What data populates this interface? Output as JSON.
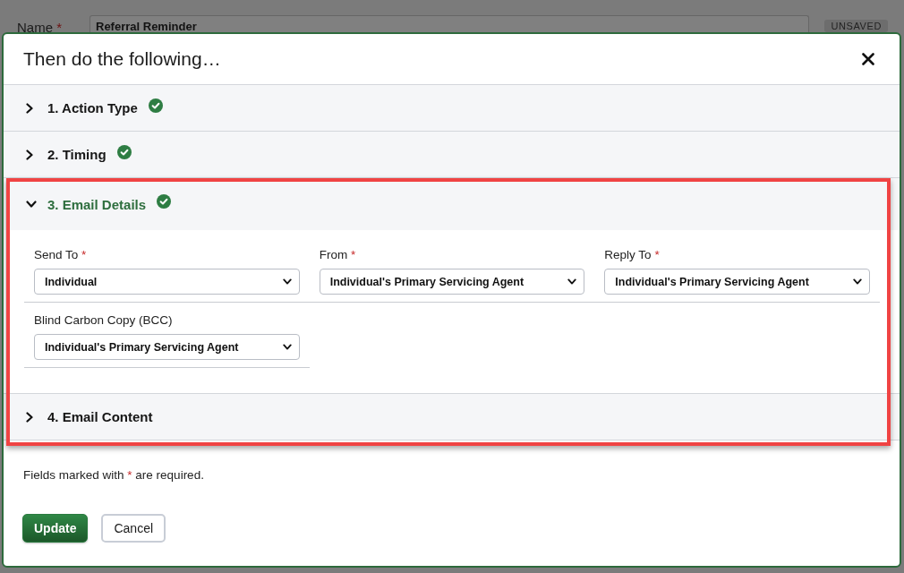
{
  "background_page": {
    "name_label": "Name",
    "required_mark": "*",
    "name_value": "Referral Reminder",
    "status_badge": "UNSAVED"
  },
  "dialog": {
    "title": "Then do the following…",
    "sections": [
      {
        "title": "1. Action Type",
        "expanded": false,
        "complete": true,
        "highlighted": false
      },
      {
        "title": "2. Timing",
        "expanded": false,
        "complete": true,
        "highlighted": false
      },
      {
        "title": "3. Email Details",
        "expanded": true,
        "complete": true,
        "highlighted": true,
        "field_rows": [
          {
            "fields": [
              {
                "label": "Send To",
                "required_mark": "*",
                "value": "Individual"
              },
              {
                "label": "From",
                "required_mark": "*",
                "value": "Individual's Primary Servicing Agent"
              },
              {
                "label": "Reply To",
                "required_mark": "*",
                "value": "Individual's Primary Servicing Agent"
              }
            ]
          },
          {
            "fields": [
              {
                "label": "Blind Carbon Copy (BCC)",
                "value": "Individual's Primary Servicing Agent"
              }
            ]
          }
        ]
      },
      {
        "title": "4. Email Content",
        "expanded": false,
        "complete": false,
        "highlighted": true
      }
    ],
    "required_note": {
      "before": "Fields marked with",
      "mark": "*",
      "after": "are required."
    },
    "buttons": [
      {
        "label": "Update",
        "kind": "primary"
      },
      {
        "label": "Cancel",
        "kind": "secondary"
      }
    ]
  }
}
